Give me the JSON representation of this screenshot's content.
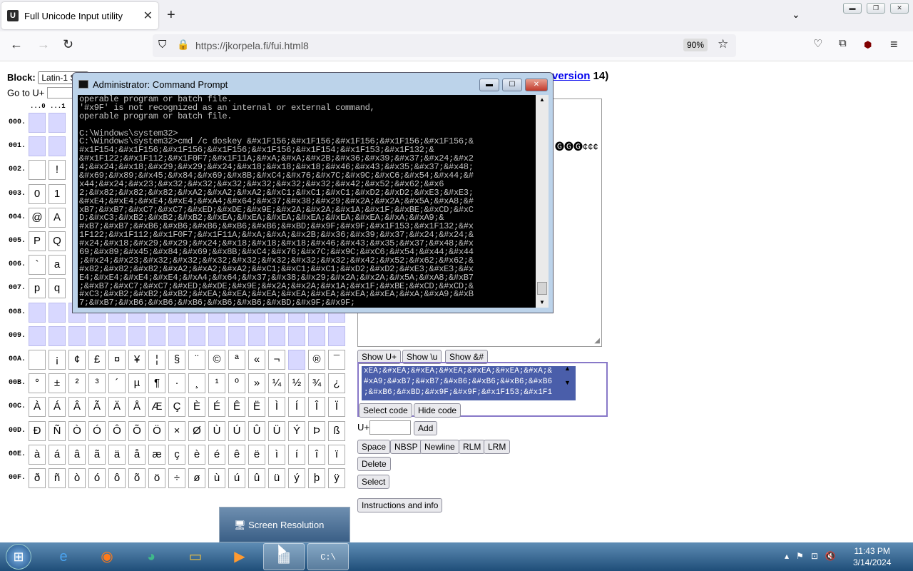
{
  "browser": {
    "tab_title": "Full Unicode Input utility",
    "url": "https://jkorpela.fi/fui.html8",
    "zoom": "90%"
  },
  "page": {
    "block_label": "Block:",
    "block_value": "Latin-1 S",
    "version_link": "version",
    "version_tail": "14)",
    "goto_label": "Go to U+",
    "col_headers": [
      "...0",
      "...1"
    ],
    "row_labels": [
      "000.",
      "001.",
      "002.",
      "003.",
      "004.",
      "005.",
      "006.",
      "007.",
      "008.",
      "009.",
      "00A.",
      "00B.",
      "00C.",
      "00D.",
      "00E.",
      "00F."
    ],
    "rows_visible": {
      "002": [
        "",
        "!"
      ],
      "003": [
        "0",
        "1"
      ],
      "004": [
        "@",
        "A"
      ],
      "005": [
        "P",
        "Q"
      ],
      "006": [
        "`",
        "a"
      ],
      "007": [
        "p",
        "q"
      ]
    },
    "row_00A": [
      "",
      "¡",
      "¢",
      "£",
      "¤",
      "¥",
      "¦",
      "§",
      "¨",
      "©",
      "ª",
      "«",
      "¬",
      "",
      "®",
      "¯"
    ],
    "row_00B": [
      "°",
      "±",
      "²",
      "³",
      "´",
      "µ",
      "¶",
      "·",
      "¸",
      "¹",
      "º",
      "»",
      "¼",
      "½",
      "¾",
      "¿"
    ],
    "row_00C": [
      "À",
      "Á",
      "Â",
      "Ã",
      "Ä",
      "Å",
      "Æ",
      "Ç",
      "È",
      "É",
      "Ê",
      "Ë",
      "Ì",
      "Í",
      "Î",
      "Ï"
    ],
    "row_00D": [
      "Ð",
      "Ñ",
      "Ò",
      "Ó",
      "Ô",
      "Õ",
      "Ö",
      "×",
      "Ø",
      "Ù",
      "Ú",
      "Û",
      "Ü",
      "Ý",
      "Þ",
      "ß"
    ],
    "row_00E": [
      "à",
      "á",
      "â",
      "ã",
      "ä",
      "å",
      "æ",
      "ç",
      "è",
      "é",
      "ê",
      "ë",
      "ì",
      "í",
      "î",
      "ï"
    ],
    "row_00F": [
      "ð",
      "ñ",
      "ò",
      "ó",
      "ô",
      "õ",
      "ö",
      "÷",
      "ø",
      "ù",
      "ú",
      "û",
      "ü",
      "ý",
      "þ",
      "ÿ"
    ],
    "textarea_chars": "🅖🅖🅖¢¢¢",
    "buttons": {
      "show_u": "Show U+",
      "show_backslash_u": "Show \\u",
      "show_amp": "Show &#",
      "select_code": "Select code",
      "hide_code": "Hide code",
      "add": "Add",
      "space": "Space",
      "nbsp": "NBSP",
      "newline": "Newline",
      "rlm": "RLM",
      "lrm": "LRM",
      "delete": "Delete",
      "select": "Select",
      "instructions": "Instructions and info"
    },
    "code_text": "xEA;&#xEA;&#xEA;&#xEA;&#xEA;&#xEA;&#xA;&\n#xA9;&#xB7;&#xB7;&#xB6;&#xB6;&#xB6;&#xB6\n;&#xB6;&#xBD;&#x9F;&#x9F;&#x1F153;&#x1F1",
    "uplus_label": "U+"
  },
  "cmd": {
    "title": "Administrator: Command Prompt",
    "lines": [
      "operable program or batch file.",
      "'#x9F' is not recognized as an internal or external command,",
      "operable program or batch file.",
      "",
      "C:\\Windows\\system32>",
      "C:\\Windows\\system32>cmd /c doskey &#x1F156;&#x1F156;&#x1F156;&#x1F156;&#x1F156;&",
      "#x1F154;&#x1F156;&#x1F156;&#x1F156;&#x1F156;&#x1F154;&#x1F153;&#x1F132;&",
      "&#x1F122;&#x1F112;&#x1F0F7;&#x1F11A;&#xA;&#xA;&#x2B;&#x36;&#x39;&#x37;&#x24;&#x2",
      "4;&#x24;&#x18;&#x29;&#x29;&#x24;&#x18;&#x18;&#x18;&#x46;&#x43;&#x35;&#x37;&#x48;",
      "&#x69;&#x89;&#x45;&#x84;&#x69;&#x8B;&#xC4;&#x76;&#x7C;&#x9C;&#xC6;&#x54;&#x44;&#",
      "x44;&#x24;&#x23;&#x32;&#x32;&#x32;&#x32;&#x32;&#x32;&#x42;&#x52;&#x62;&#x6",
      "2;&#x82;&#x82;&#x82;&#xA2;&#xA2;&#xA2;&#xC1;&#xC1;&#xC1;&#xD2;&#xD2;&#xE3;&#xE3;",
      "&#xE4;&#xE4;&#xE4;&#xE4;&#xA4;&#x64;&#x37;&#x38;&#x29;&#x2A;&#x2A;&#x5A;&#xA8;&#",
      "xB7;&#xB7;&#xC7;&#xC7;&#xED;&#xDE;&#x9E;&#x2A;&#x2A;&#x1A;&#x1F;&#xBE;&#xCD;&#xC",
      "D;&#xC3;&#xB2;&#xB2;&#xB2;&#xEA;&#xEA;&#xEA;&#xEA;&#xEA;&#xEA;&#xA;&#xA9;&",
      "#xB7;&#xB7;&#xB6;&#xB6;&#xB6;&#xB6;&#xB6;&#xBD;&#x9F;&#x9F;&#x1F153;&#x1F132;&#x",
      "1F122;&#x1F112;&#x1F0F7;&#x1F11A;&#xA;&#xA;&#x2B;&#x36;&#x39;&#x37;&#x24;&#x24;&",
      "#x24;&#x18;&#x29;&#x29;&#x24;&#x18;&#x18;&#x18;&#x46;&#x43;&#x35;&#x37;&#x48;&#x",
      "69;&#x89;&#x45;&#x84;&#x69;&#x8B;&#xC4;&#x76;&#x7C;&#x9C;&#xC6;&#x54;&#x44;&#x44",
      ";&#x24;&#x23;&#x32;&#x32;&#x32;&#x32;&#x32;&#x32;&#x32;&#x42;&#x52;&#x62;&#x62;&",
      "#x82;&#x82;&#x82;&#xA2;&#xA2;&#xA2;&#xC1;&#xC1;&#xC1;&#xD2;&#xD2;&#xE3;&#xE3;&#x",
      "E4;&#xE4;&#xE4;&#xE4;&#xA4;&#x64;&#x37;&#x38;&#x29;&#x2A;&#x2A;&#x5A;&#xA8;&#xB7",
      ";&#xB7;&#xC7;&#xC7;&#xED;&#xDE;&#x9E;&#x2A;&#x2A;&#x1A;&#x1F;&#xBE;&#xCD;&#xCD;&",
      "#xC3;&#xB2;&#xB2;&#xB2;&#xEA;&#xEA;&#xEA;&#xEA;&#xEA;&#xEA;&#xEA;&#xA;&#xA9;&#xB",
      "7;&#xB7;&#xB6;&#xB6;&#xB6;&#xB6;&#xB6;&#xBD;&#x9F;&#x9F;"
    ]
  },
  "taskbar": {
    "popup": "Screen Resolution",
    "time": "11:43 PM",
    "date": "3/14/2024"
  }
}
